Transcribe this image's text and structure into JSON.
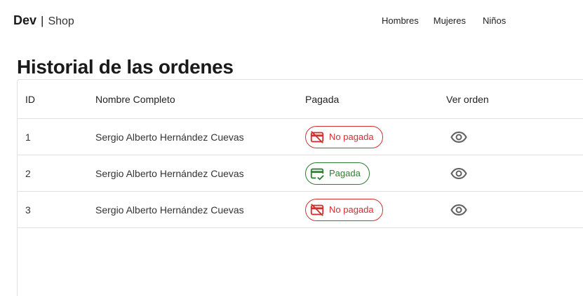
{
  "navbar": {
    "brand_main": "Dev",
    "brand_sep": "|",
    "brand_sub": "Shop",
    "links": [
      "Hombres",
      "Mujeres",
      "Niños"
    ]
  },
  "page": {
    "title": "Historial de las ordenes"
  },
  "table": {
    "columns": [
      "ID",
      "Nombre Completo",
      "Pagada",
      "Ver orden"
    ],
    "rows": [
      {
        "id": "1",
        "name": "Sergio Alberto Hernández Cuevas",
        "status": "No pagada"
      },
      {
        "id": "2",
        "name": "Sergio Alberto Hernández Cuevas",
        "status": "Pagada"
      },
      {
        "id": "3",
        "name": "Sergio Alberto Hernández Cuevas",
        "status": "No pagada"
      }
    ]
  },
  "colors": {
    "unpaid": "#d32f2f",
    "paid": "#2e7d32",
    "icon": "#616161"
  },
  "icons": {
    "unpaid": "credit-card-off-icon",
    "paid": "credit-score-icon",
    "view": "eye-icon"
  }
}
